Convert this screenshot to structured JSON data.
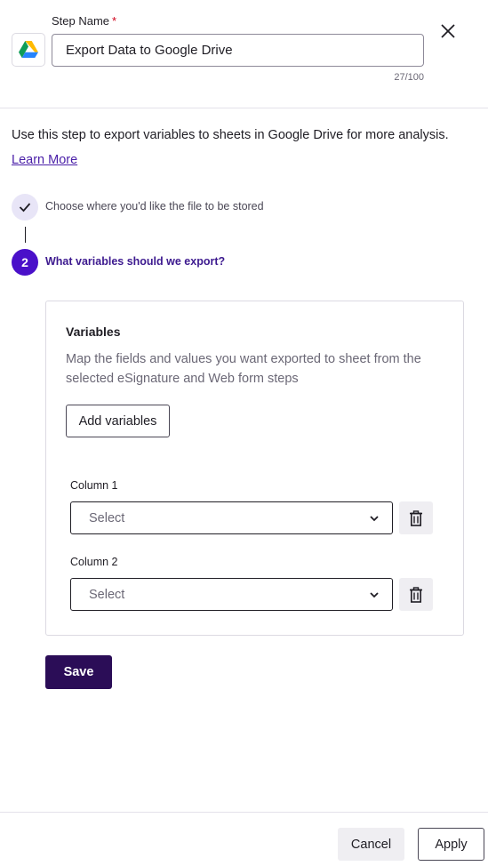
{
  "header": {
    "icon": "google-drive-icon",
    "step_name_label": "Step Name",
    "required_marker": "*",
    "step_name_value": "Export Data to Google Drive",
    "char_count": "27/100",
    "close_icon": "close-icon"
  },
  "description": "Use this step to export variables to sheets in Google Drive for more analysis.",
  "learn_more": "Learn More",
  "steps": [
    {
      "status": "complete",
      "icon": "checkmark-icon",
      "label": "Choose where you'd like the file to be stored"
    },
    {
      "status": "current",
      "number": "2",
      "label": "What variables should we export?"
    }
  ],
  "variables_card": {
    "title": "Variables",
    "description": "Map the fields and values you want exported to sheet from the selected eSignature and Web form steps",
    "add_button": "Add variables",
    "columns": [
      {
        "label": "Column 1",
        "placeholder": "Select"
      },
      {
        "label": "Column 2",
        "placeholder": "Select"
      }
    ]
  },
  "save_button": "Save",
  "footer": {
    "cancel": "Cancel",
    "apply": "Apply"
  },
  "colors": {
    "accent": "#4a10c9",
    "link": "#4a1fa8",
    "primary_button": "#2b0d57"
  }
}
